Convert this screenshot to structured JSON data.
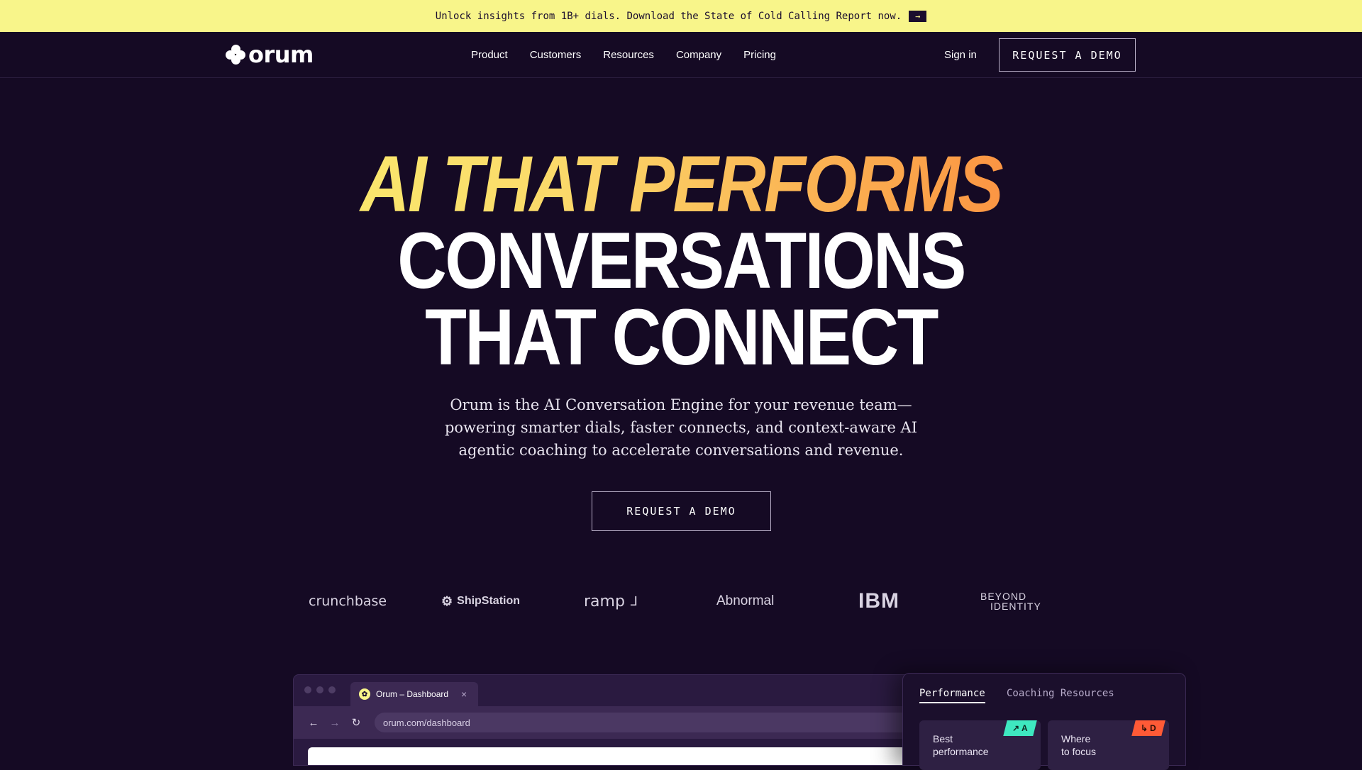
{
  "banner": {
    "text": "Unlock insights from 1B+ dials. Download the State of Cold Calling Report now.",
    "arrow_icon": "arrow-right-icon"
  },
  "nav": {
    "logo_text": "orum",
    "links": [
      "Product",
      "Customers",
      "Resources",
      "Company",
      "Pricing"
    ],
    "signin": "Sign in",
    "demo_button": "REQUEST A DEMO"
  },
  "hero": {
    "line1": "AI THAT PERFORMS",
    "line2": "CONVERSATIONS",
    "line3": "THAT CONNECT",
    "subtitle_1": "Orum is the AI Conversation Engine for your revenue team—",
    "subtitle_2": "powering smarter dials, faster connects, and context-aware AI",
    "subtitle_3": "agentic coaching to accelerate conversations and revenue.",
    "cta": "REQUEST A DEMO",
    "gradient": [
      "#f9f871",
      "#fbd96a",
      "#fb9a45",
      "#fb6b3a"
    ]
  },
  "logos": [
    "crunchbase",
    "ShipStation",
    "ramp",
    "Abnormal",
    "IBM",
    "BEYOND",
    "IDENTITY"
  ],
  "browser": {
    "tab_title": "Orum – Dashboard",
    "tab_close": "×",
    "url": "orum.com/dashboard",
    "icons": [
      "back-arrow-icon",
      "forward-arrow-icon",
      "reload-icon"
    ]
  },
  "panel": {
    "tabs": [
      "Performance",
      "Coaching Resources"
    ],
    "cards": [
      {
        "line1": "Best",
        "line2": "performance",
        "badge": "A",
        "badge_icon": "trend-up-icon",
        "badge_color": "#3ee8c0"
      },
      {
        "line1": "Where",
        "line2": "to focus",
        "badge": "D",
        "badge_icon": "return-arrow-icon",
        "badge_color": "#ff5a36"
      }
    ]
  }
}
